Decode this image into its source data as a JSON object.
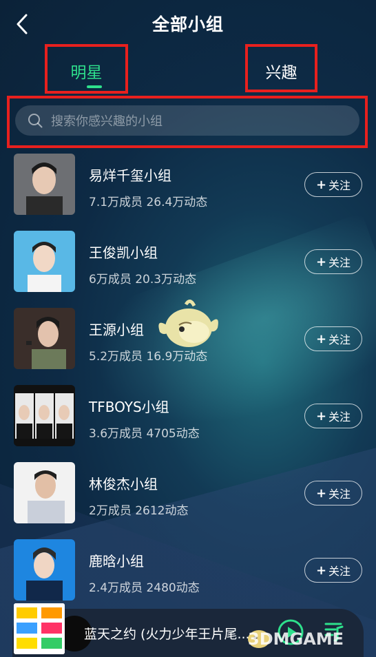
{
  "header": {
    "title": "全部小组"
  },
  "tabs": [
    {
      "label": "明星",
      "active": true
    },
    {
      "label": "兴趣",
      "active": false
    }
  ],
  "search": {
    "placeholder": "搜索你感兴趣的小组"
  },
  "colors": {
    "accent": "#2ee08c",
    "highlight_box": "#e8201e"
  },
  "groups": [
    {
      "name": "易烊千玺小组",
      "stats": "7.1万成员 26.4万动态",
      "follow_label": "关注"
    },
    {
      "name": "王俊凯小组",
      "stats": "6万成员 20.3万动态",
      "follow_label": "关注"
    },
    {
      "name": "王源小组",
      "stats": "5.2万成员 16.9万动态",
      "follow_label": "关注"
    },
    {
      "name": "TFBOYS小组",
      "stats": "3.6万成员 4705动态",
      "follow_label": "关注"
    },
    {
      "name": "林俊杰小组",
      "stats": "2万成员 2612动态",
      "follow_label": "关注"
    },
    {
      "name": "鹿晗小组",
      "stats": "2.4万成员 2480动态",
      "follow_label": "关注"
    }
  ],
  "player": {
    "song_title": "蓝天之约 (火力少年王片尾..."
  },
  "watermark": {
    "text": "3DMGAME"
  }
}
